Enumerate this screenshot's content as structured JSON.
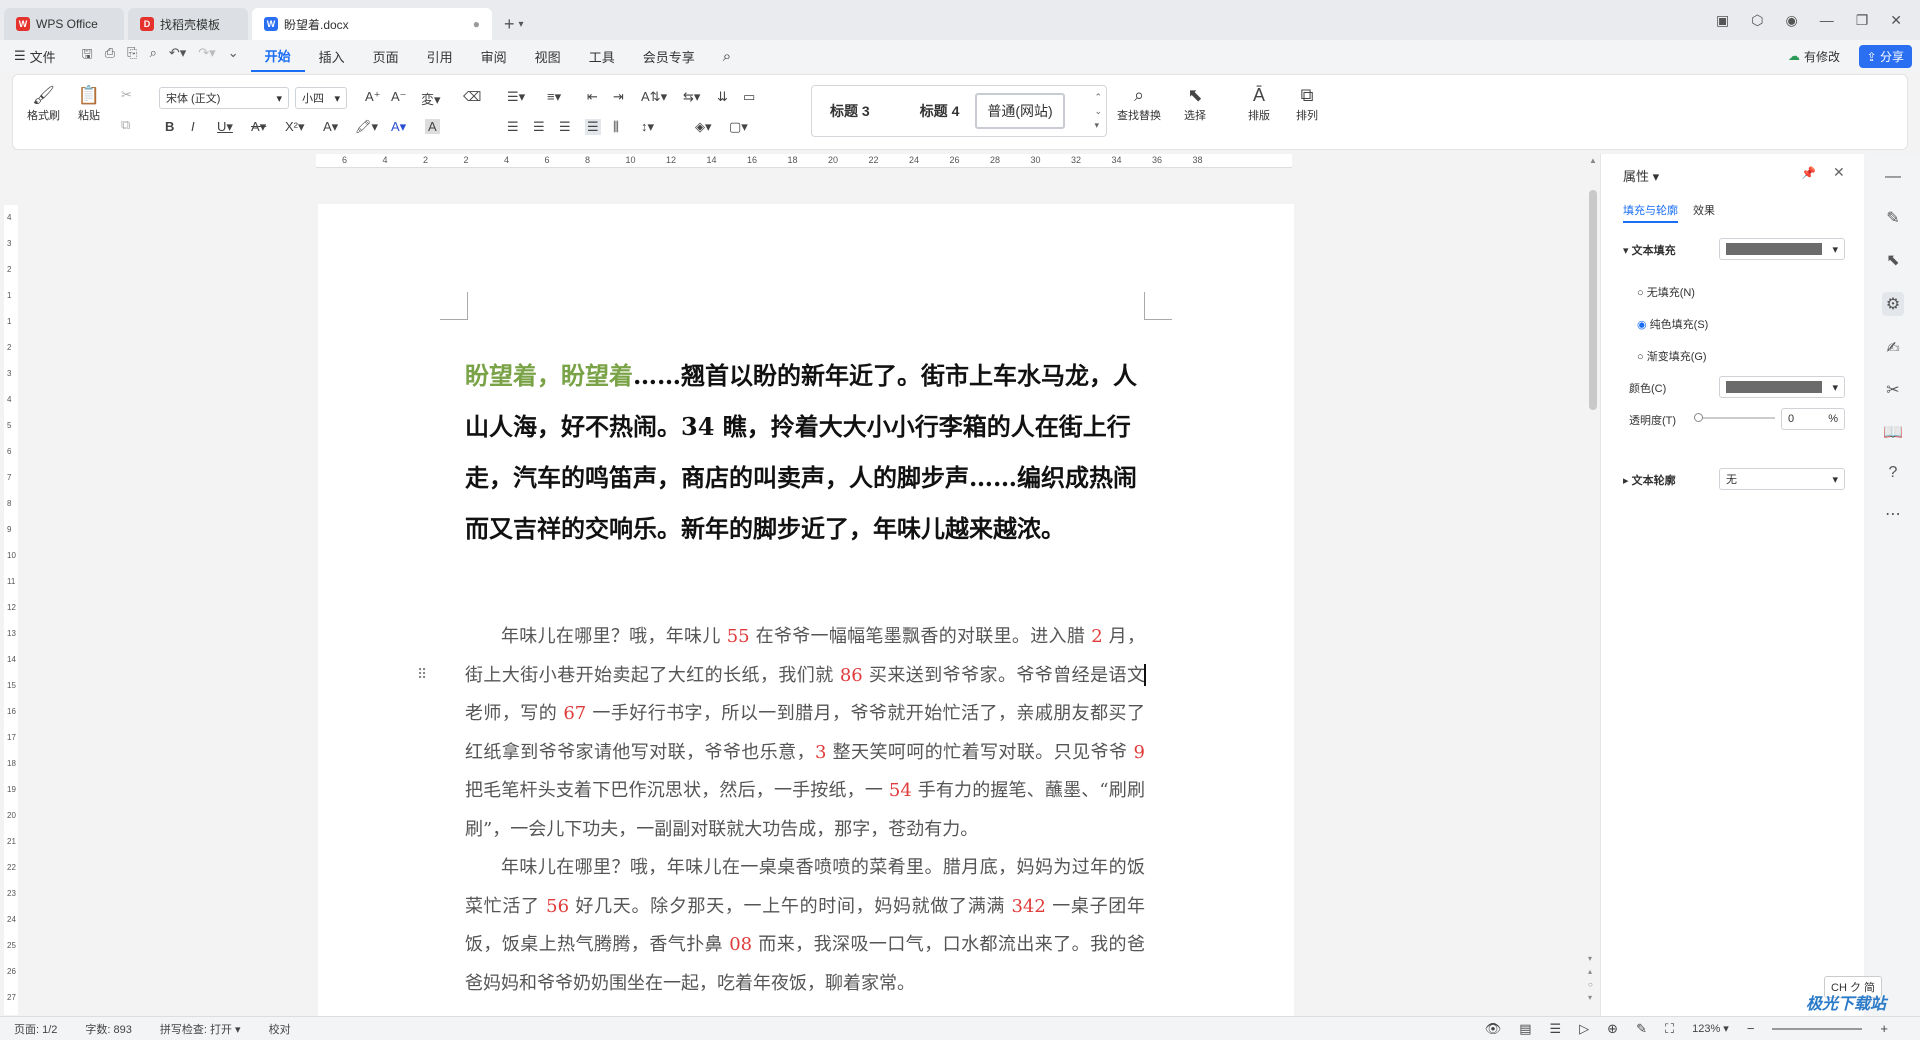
{
  "tabs": [
    {
      "label": "WPS Office"
    },
    {
      "label": "找稻壳模板"
    },
    {
      "label": "盼望着.docx"
    }
  ],
  "menu": {
    "file": "文件",
    "items": [
      "开始",
      "插入",
      "页面",
      "引用",
      "审阅",
      "视图",
      "工具",
      "会员专享"
    ],
    "active": "开始",
    "modified": "有修改",
    "share": "分享"
  },
  "ribbon": {
    "format_painter": "格式刷",
    "paste": "粘贴",
    "font": "宋体 (正文)",
    "size": "小四",
    "styles": [
      "标题 3",
      "标题 4",
      "普通(网站)"
    ],
    "find_replace": "查找替换",
    "select": "选择",
    "layout": "排版",
    "arrange": "排列"
  },
  "ruler_ticks": [
    "6",
    "4",
    "2",
    "2",
    "4",
    "6",
    "8",
    "10",
    "12",
    "14",
    "16",
    "18",
    "20",
    "22",
    "24",
    "26",
    "28",
    "30",
    "32",
    "34",
    "36",
    "38"
  ],
  "vruler_ticks": [
    "4",
    "3",
    "2",
    "1",
    "1",
    "2",
    "3",
    "4",
    "5",
    "6",
    "7",
    "8",
    "9",
    "10",
    "11",
    "12",
    "13",
    "14",
    "15",
    "16",
    "17",
    "18",
    "19",
    "20",
    "21",
    "22",
    "23",
    "24",
    "25",
    "26",
    "27"
  ],
  "document": {
    "heading_hl": "盼望着，盼望着",
    "heading_rest": "……翘首以盼的新年近了。街市上车水马龙，人山人海，好不热闹。34 瞧，拎着大大小小行李箱的人在街上行走，汽车的鸣笛声，商店的叫卖声，人的脚步声……编织成热闹而又吉祥的交响乐。新年的脚步近了，年味儿越来越浓。",
    "p1": [
      {
        "t": "年味儿在哪里？哦，年味儿 "
      },
      {
        "t": "55",
        "n": true
      },
      {
        "t": " 在爷爷一幅幅笔墨飘香的对联里。进入腊 "
      },
      {
        "t": "2",
        "n": true
      },
      {
        "t": " 月，街上大街小巷开始卖起了大红的长纸，我们就 "
      },
      {
        "t": "86",
        "n": true
      },
      {
        "t": " 买来送到爷爷家。爷爷曾经是语文老师，写的 "
      },
      {
        "t": "67",
        "n": true
      },
      {
        "t": " 一手好行书字，所以一到腊月，爷爷就开始忙活了，亲戚朋友都买了红纸拿到爷爷家请他写对联，爷爷也乐意，"
      },
      {
        "t": "3",
        "n": true
      },
      {
        "t": " 整天笑呵呵的忙着写对联。只见爷爷 "
      },
      {
        "t": "9",
        "n": true
      },
      {
        "t": " 把毛笔杆头支着下巴作沉思状，然后，一手按纸，一 "
      },
      {
        "t": "54",
        "n": true
      },
      {
        "t": " 手有力的握笔、蘸墨、“刷刷刷”，一会儿下功夫，一副副对联就大功告成，那字，苍劲有力。"
      }
    ],
    "p2": [
      {
        "t": "年味儿在哪里？哦，年味儿在一桌桌香喷喷的菜肴里。腊月底，妈妈为过年的饭菜忙活了 "
      },
      {
        "t": "56",
        "n": true
      },
      {
        "t": " 好几天。除夕那天，一上午的时间，妈妈就做了满满 "
      },
      {
        "t": "342",
        "n": true
      },
      {
        "t": " 一桌子团年饭，饭桌上热气腾腾，香气扑鼻 "
      },
      {
        "t": "08",
        "n": true
      },
      {
        "t": " 而来，我深吸一口气，口水都流出来了。我的爸爸妈妈和爷爷奶奶围坐在一起，吃着年夜饭，聊着家常。"
      }
    ]
  },
  "panel": {
    "title": "属性",
    "tab_fill": "填充与轮廓",
    "tab_effect": "效果",
    "text_fill": "文本填充",
    "no_fill": "无填充(N)",
    "solid_fill": "纯色填充(S)",
    "gradient_fill": "渐变填充(G)",
    "color": "颜色(C)",
    "transparency": "透明度(T)",
    "transparency_value": "0",
    "percent": "%",
    "text_outline": "文本轮廓",
    "outline_value": "无",
    "fill_color": "#6b6b6b"
  },
  "status": {
    "page": "页面: 1/2",
    "words": "字数: 893",
    "spell": "拼写检查: 打开",
    "proof": "校对",
    "zoom": "123%",
    "ime": "CH ク 简"
  },
  "watermark": "极光下载站"
}
